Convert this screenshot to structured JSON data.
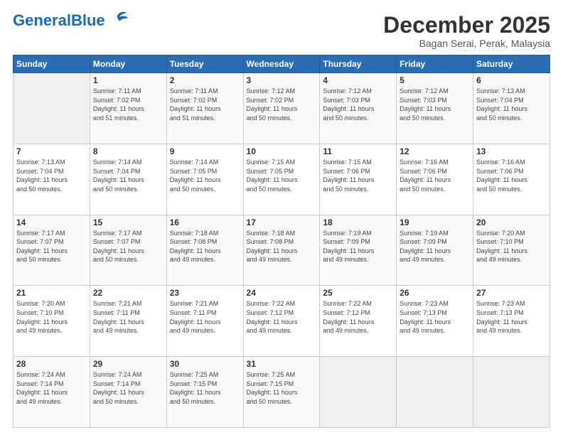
{
  "logo": {
    "line1": "General",
    "line2": "Blue"
  },
  "header": {
    "month": "December 2025",
    "location": "Bagan Serai, Perak, Malaysia"
  },
  "days_of_week": [
    "Sunday",
    "Monday",
    "Tuesday",
    "Wednesday",
    "Thursday",
    "Friday",
    "Saturday"
  ],
  "weeks": [
    [
      {
        "day": "",
        "info": ""
      },
      {
        "day": "1",
        "info": "Sunrise: 7:11 AM\nSunset: 7:02 PM\nDaylight: 11 hours\nand 51 minutes."
      },
      {
        "day": "2",
        "info": "Sunrise: 7:11 AM\nSunset: 7:02 PM\nDaylight: 11 hours\nand 51 minutes."
      },
      {
        "day": "3",
        "info": "Sunrise: 7:12 AM\nSunset: 7:02 PM\nDaylight: 11 hours\nand 50 minutes."
      },
      {
        "day": "4",
        "info": "Sunrise: 7:12 AM\nSunset: 7:03 PM\nDaylight: 11 hours\nand 50 minutes."
      },
      {
        "day": "5",
        "info": "Sunrise: 7:12 AM\nSunset: 7:03 PM\nDaylight: 11 hours\nand 50 minutes."
      },
      {
        "day": "6",
        "info": "Sunrise: 7:13 AM\nSunset: 7:04 PM\nDaylight: 11 hours\nand 50 minutes."
      }
    ],
    [
      {
        "day": "7",
        "info": "Sunrise: 7:13 AM\nSunset: 7:04 PM\nDaylight: 11 hours\nand 50 minutes."
      },
      {
        "day": "8",
        "info": "Sunrise: 7:14 AM\nSunset: 7:04 PM\nDaylight: 11 hours\nand 50 minutes."
      },
      {
        "day": "9",
        "info": "Sunrise: 7:14 AM\nSunset: 7:05 PM\nDaylight: 11 hours\nand 50 minutes."
      },
      {
        "day": "10",
        "info": "Sunrise: 7:15 AM\nSunset: 7:05 PM\nDaylight: 11 hours\nand 50 minutes."
      },
      {
        "day": "11",
        "info": "Sunrise: 7:15 AM\nSunset: 7:06 PM\nDaylight: 11 hours\nand 50 minutes."
      },
      {
        "day": "12",
        "info": "Sunrise: 7:16 AM\nSunset: 7:06 PM\nDaylight: 11 hours\nand 50 minutes."
      },
      {
        "day": "13",
        "info": "Sunrise: 7:16 AM\nSunset: 7:06 PM\nDaylight: 11 hours\nand 50 minutes."
      }
    ],
    [
      {
        "day": "14",
        "info": "Sunrise: 7:17 AM\nSunset: 7:07 PM\nDaylight: 11 hours\nand 50 minutes."
      },
      {
        "day": "15",
        "info": "Sunrise: 7:17 AM\nSunset: 7:07 PM\nDaylight: 11 hours\nand 50 minutes."
      },
      {
        "day": "16",
        "info": "Sunrise: 7:18 AM\nSunset: 7:08 PM\nDaylight: 11 hours\nand 49 minutes."
      },
      {
        "day": "17",
        "info": "Sunrise: 7:18 AM\nSunset: 7:08 PM\nDaylight: 11 hours\nand 49 minutes."
      },
      {
        "day": "18",
        "info": "Sunrise: 7:19 AM\nSunset: 7:09 PM\nDaylight: 11 hours\nand 49 minutes."
      },
      {
        "day": "19",
        "info": "Sunrise: 7:19 AM\nSunset: 7:09 PM\nDaylight: 11 hours\nand 49 minutes."
      },
      {
        "day": "20",
        "info": "Sunrise: 7:20 AM\nSunset: 7:10 PM\nDaylight: 11 hours\nand 49 minutes."
      }
    ],
    [
      {
        "day": "21",
        "info": "Sunrise: 7:20 AM\nSunset: 7:10 PM\nDaylight: 11 hours\nand 49 minutes."
      },
      {
        "day": "22",
        "info": "Sunrise: 7:21 AM\nSunset: 7:11 PM\nDaylight: 11 hours\nand 49 minutes."
      },
      {
        "day": "23",
        "info": "Sunrise: 7:21 AM\nSunset: 7:11 PM\nDaylight: 11 hours\nand 49 minutes."
      },
      {
        "day": "24",
        "info": "Sunrise: 7:22 AM\nSunset: 7:12 PM\nDaylight: 11 hours\nand 49 minutes."
      },
      {
        "day": "25",
        "info": "Sunrise: 7:22 AM\nSunset: 7:12 PM\nDaylight: 11 hours\nand 49 minutes."
      },
      {
        "day": "26",
        "info": "Sunrise: 7:23 AM\nSunset: 7:13 PM\nDaylight: 11 hours\nand 49 minutes."
      },
      {
        "day": "27",
        "info": "Sunrise: 7:23 AM\nSunset: 7:13 PM\nDaylight: 11 hours\nand 49 minutes."
      }
    ],
    [
      {
        "day": "28",
        "info": "Sunrise: 7:24 AM\nSunset: 7:14 PM\nDaylight: 11 hours\nand 49 minutes."
      },
      {
        "day": "29",
        "info": "Sunrise: 7:24 AM\nSunset: 7:14 PM\nDaylight: 11 hours\nand 50 minutes."
      },
      {
        "day": "30",
        "info": "Sunrise: 7:25 AM\nSunset: 7:15 PM\nDaylight: 11 hours\nand 50 minutes."
      },
      {
        "day": "31",
        "info": "Sunrise: 7:25 AM\nSunset: 7:15 PM\nDaylight: 11 hours\nand 50 minutes."
      },
      {
        "day": "",
        "info": ""
      },
      {
        "day": "",
        "info": ""
      },
      {
        "day": "",
        "info": ""
      }
    ]
  ]
}
